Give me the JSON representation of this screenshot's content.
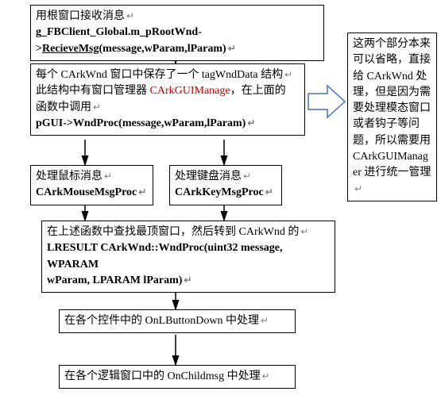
{
  "return_mark": "↵",
  "boxes": {
    "b1": {
      "line1": "用根窗口接收消息",
      "line2_pre": "g_FBClient_Global.m_pRootWnd->",
      "line2_u": "RecieveMsg",
      "line2_post": "(message,wParam,lParam)"
    },
    "b2": {
      "line1_pre": "每个 CArkWnd 窗口中保存了一个 tagWndData 结构",
      "line2_pre": "此结构中有窗口管理器 ",
      "line2_red": "CArkGUIManage",
      "line2_post": "，在上面的",
      "line3": "函数中调用",
      "line4": "pGUI->WndProc(message,wParam,lParam)"
    },
    "b3": {
      "line1": "处理鼠标消息",
      "line2": "CArkMouseMsgProc"
    },
    "b4": {
      "line1": "处理键盘消息",
      "line2": "CArkKeyMsgProc"
    },
    "b5": {
      "line1": "在上述函数中查找最顶窗口，然后转到 CArkWnd 的",
      "line2": "LRESULT  CArkWnd::WndProc(uint32  message,  WPARAM",
      "line3": "wParam, LPARAM    lParam)"
    },
    "b6": {
      "line1": "在各个控件中的 OnLButtonDown 中处理"
    },
    "b7": {
      "line1": "在各个逻辑窗口中的 OnChildmsg 中处理"
    },
    "side": {
      "t1": "这两个部分本来",
      "t2": "可以省略，直接",
      "t3": "给 CArkWnd 处",
      "t4": "理，但是因为需",
      "t5": "要处理模态窗口",
      "t6": "或者钩子等问",
      "t7": "题，所以需要用",
      "t8": "CArkGUIManag",
      "t9": "er 进行统一管理"
    }
  }
}
